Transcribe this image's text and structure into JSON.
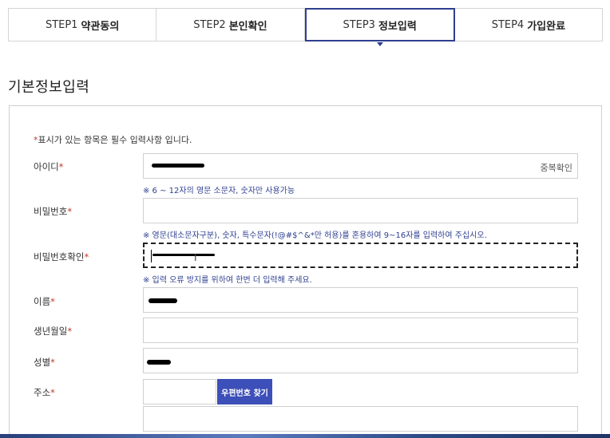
{
  "steps": [
    {
      "num": "STEP1",
      "label": "약관동의"
    },
    {
      "num": "STEP2",
      "label": "본인확인"
    },
    {
      "num": "STEP3",
      "label": "정보입력"
    },
    {
      "num": "STEP4",
      "label": "가입완료"
    }
  ],
  "active_step": 3,
  "section_title": "기본정보입력",
  "notice": {
    "mark": "*",
    "text": "표시가 있는 항목은 필수 입력사항 입니다."
  },
  "fields": {
    "userid": {
      "label": "아이디",
      "mark": "*",
      "dup_check": "중복확인",
      "hint": "※ 6 ~ 12자의 영문 소문자, 숫자만 사용가능"
    },
    "password": {
      "label": "비밀번호",
      "mark": "*",
      "hint": "※ 영문(대소문자구분), 숫자, 특수문자(!@#$^&*만 허용)를 혼용하여 9~16자를 입력하여 주십시오."
    },
    "password_confirm": {
      "label": "비밀번호확인",
      "mark": "*",
      "hint": "※ 입력 오류 방지를 위하여 한번 더 입력해 주세요."
    },
    "name": {
      "label": "이름",
      "mark": "*"
    },
    "birth": {
      "label": "생년월일",
      "mark": "*"
    },
    "gender": {
      "label": "성별",
      "mark": "*"
    },
    "address": {
      "label": "주소",
      "mark": "*",
      "zip_button": "우편번호 찾기"
    }
  },
  "colors": {
    "accent": "#2e3f8f",
    "button": "#3d4fb8",
    "required": "#c0392b"
  }
}
